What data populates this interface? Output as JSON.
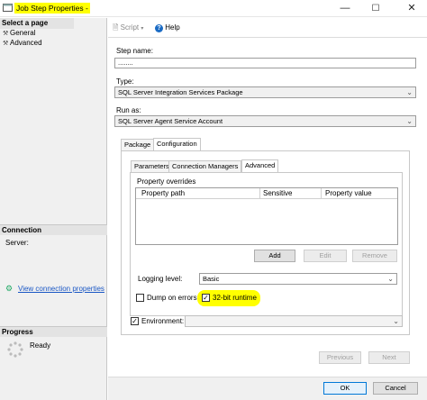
{
  "window": {
    "title": "Job Step Properties - ",
    "min_glyph": "—",
    "max_glyph": "☐",
    "close_glyph": "✕"
  },
  "left": {
    "select_page_header": "Select a page",
    "pages": [
      {
        "label": "General",
        "icon": "wrench-icon"
      },
      {
        "label": "Advanced",
        "icon": "wrench-icon"
      }
    ],
    "connection_header": "Connection",
    "server_label": "Server:",
    "view_connection_link": "View connection properties",
    "progress_header": "Progress",
    "progress_status": "Ready"
  },
  "toolbar": {
    "script_label": "Script",
    "help_label": "Help"
  },
  "form": {
    "step_name_label": "Step name:",
    "step_name_value": "........",
    "type_label": "Type:",
    "type_value": "SQL Server Integration Services Package",
    "run_as_label": "Run as:",
    "run_as_value": "SQL Server Agent Service Account"
  },
  "outer_tabs": [
    {
      "label": "Package",
      "active": false
    },
    {
      "label": "Configuration",
      "active": true
    }
  ],
  "inner_tabs": [
    {
      "label": "Parameters",
      "active": false
    },
    {
      "label": "Connection Managers",
      "active": false
    },
    {
      "label": "Advanced",
      "active": true
    }
  ],
  "property_overrides": {
    "label": "Property overrides",
    "columns": [
      "Property path",
      "Sensitive",
      "Property value"
    ],
    "add_label": "Add",
    "edit_label": "Edit",
    "remove_label": "Remove"
  },
  "logging": {
    "label": "Logging level:",
    "value": "Basic"
  },
  "options": {
    "dump_on_errors_label": "Dump on errors",
    "dump_on_errors_checked": false,
    "runtime_32bit_label": "32-bit runtime",
    "runtime_32bit_checked": true
  },
  "environment": {
    "label": "Environment:",
    "checked": true,
    "value": ""
  },
  "nav": {
    "previous_label": "Previous",
    "next_label": "Next"
  },
  "footer": {
    "ok_label": "OK",
    "cancel_label": "Cancel"
  },
  "colors": {
    "highlight": "#ffff00",
    "link": "#1a57c5",
    "panel": "#f0f0f0"
  }
}
